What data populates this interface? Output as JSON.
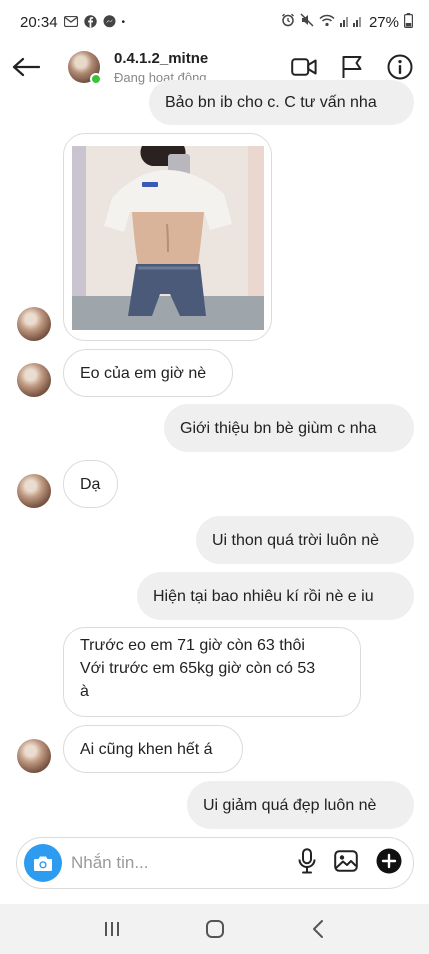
{
  "status_bar": {
    "time": "20:34",
    "left_icons": [
      "gmail-icon",
      "facebook-icon",
      "messenger-icon"
    ],
    "dot": "•",
    "battery": "27%"
  },
  "header": {
    "username": "0.4.1.2_mitne",
    "status": "Đang hoạt động"
  },
  "messages": [
    {
      "id": "m1",
      "direction": "outgoing",
      "text": "Bảo bn ib cho c. C tư vấn nha"
    },
    {
      "id": "m2",
      "direction": "incoming",
      "type": "photo"
    },
    {
      "id": "m3",
      "direction": "incoming",
      "text": "Eo của em giờ nè"
    },
    {
      "id": "m4",
      "direction": "outgoing",
      "text": "Giới thiệu bn bè giùm c nha"
    },
    {
      "id": "m5",
      "direction": "incoming",
      "text": "Dạ"
    },
    {
      "id": "m6",
      "direction": "outgoing",
      "text": "Ui thon quá trời luôn nè"
    },
    {
      "id": "m7",
      "direction": "outgoing",
      "text": "Hiện tại bao nhiêu kí rồi nè e iu"
    },
    {
      "id": "m8",
      "direction": "incoming",
      "lines": [
        "Trước eo em 71 giờ còn 63 thôi",
        "Với trước em 65kg giờ còn có 53",
        "à"
      ]
    },
    {
      "id": "m9",
      "direction": "incoming",
      "text": "Ai cũng khen hết á"
    },
    {
      "id": "m10",
      "direction": "outgoing",
      "text": "Ui giảm quá đẹp luôn nè"
    }
  ],
  "composer": {
    "placeholder": "Nhắn tin..."
  },
  "colors": {
    "accent": "#2d9bf0",
    "online": "#3cc13b",
    "outgoing_bubble": "#efefef",
    "incoming_border": "#dbdbdb"
  }
}
